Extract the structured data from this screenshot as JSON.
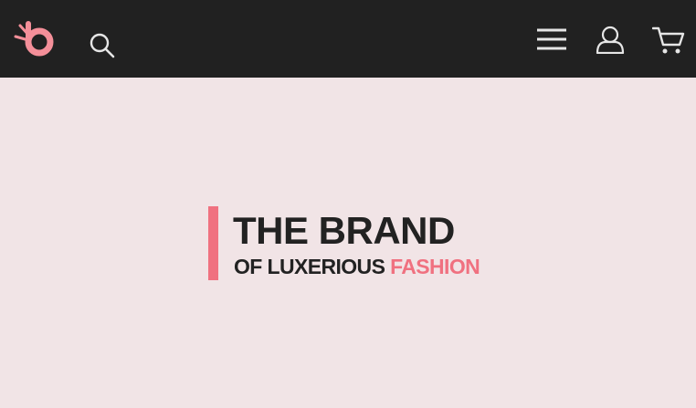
{
  "header": {
    "logo_icon": "brand-logo-icon",
    "search_icon": "search-icon",
    "menu_icon": "hamburger-menu-icon",
    "account_icon": "user-icon",
    "cart_icon": "shopping-cart-icon",
    "background": "#212121"
  },
  "hero": {
    "headline": "THE BRAND",
    "subline_prefix": "OF LUXERIOUS",
    "subline_highlight": "FASHION",
    "accent_color": "#f07180",
    "background": "#f1e4e6",
    "text_color": "#222222"
  }
}
